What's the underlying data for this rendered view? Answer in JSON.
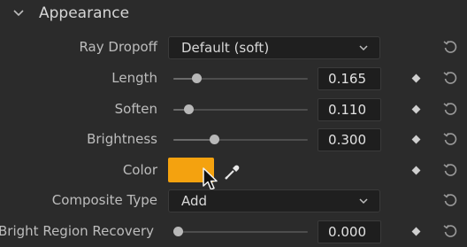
{
  "section": {
    "title": "Appearance"
  },
  "colors": {
    "swatch": "#f4a20f",
    "panel": "#2b2b2b"
  },
  "rows": {
    "ray_dropoff": {
      "label": "Ray Dropoff",
      "value": "Default (soft)"
    },
    "length": {
      "label": "Length",
      "value": "0.165",
      "slider_fraction": 0.17
    },
    "soften": {
      "label": "Soften",
      "value": "0.110",
      "slider_fraction": 0.11
    },
    "brightness": {
      "label": "Brightness",
      "value": "0.300",
      "slider_fraction": 0.3
    },
    "color": {
      "label": "Color"
    },
    "composite_type": {
      "label": "Composite Type",
      "value": "Add"
    },
    "bright_region_recovery": {
      "label": "Bright Region Recovery",
      "value": "0.000",
      "slider_fraction": 0.0
    }
  },
  "icons": {
    "chevron": "chevron-down-icon",
    "keyframe": "keyframe-diamond-icon",
    "reset": "reset-icon",
    "eyedropper": "eyedropper-icon",
    "cursor": "mouse-cursor-icon"
  }
}
